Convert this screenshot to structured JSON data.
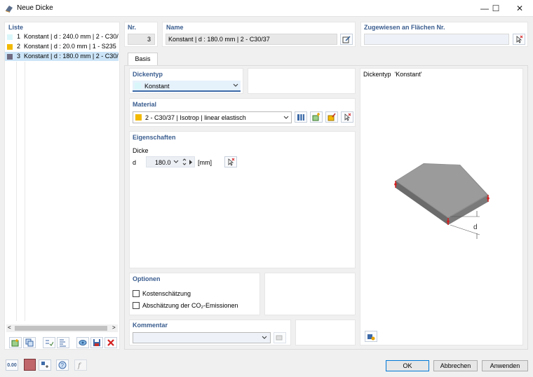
{
  "window": {
    "title": "Neue Dicke",
    "minimize": "—",
    "maximize": "☐",
    "close": "✕"
  },
  "list": {
    "header": "Liste",
    "items": [
      {
        "num": "1",
        "label": "Konstant | d : 240.0 mm | 2 - C30/37",
        "color": "#d9f7fb"
      },
      {
        "num": "2",
        "label": "Konstant | d : 20.0 mm | 1 - S235",
        "color": "#f2b900"
      },
      {
        "num": "3",
        "label": "Konstant | d : 180.0 mm | 2 - C30/37",
        "color": "#6f6a80",
        "selected": true
      }
    ],
    "scroll_left": "<",
    "scroll_right": ">"
  },
  "nr": {
    "header": "Nr.",
    "value": "3"
  },
  "name": {
    "header": "Name",
    "value": "Konstant | d : 180.0 mm | 2 - C30/37"
  },
  "assigned": {
    "header": "Zugewiesen an Flächen Nr.",
    "value": ""
  },
  "tabs": [
    {
      "label": "Basis"
    }
  ],
  "thickness_type": {
    "header": "Dickentyp",
    "value": "Konstant",
    "color": "#d9f7fb"
  },
  "material": {
    "header": "Material",
    "value": "2 - C30/37 | Isotrop | linear elastisch",
    "color": "#f2b900"
  },
  "properties": {
    "header": "Eigenschaften",
    "sub": "Dicke",
    "param": "d",
    "value": "180.0",
    "unit": "[mm]"
  },
  "options": {
    "header": "Optionen",
    "cost": "Kostenschätzung",
    "co2": "Abschätzung der CO₂-Emissionen"
  },
  "comment": {
    "header": "Kommentar",
    "value": ""
  },
  "preview": {
    "title": "Dickentyp  'Konstant'",
    "dim_label": "d"
  },
  "buttons": {
    "ok": "OK",
    "cancel": "Abbrechen",
    "apply": "Anwenden"
  },
  "bottom": {
    "zero_label": "0.00"
  }
}
